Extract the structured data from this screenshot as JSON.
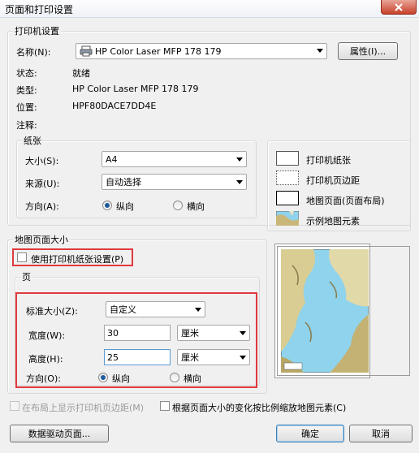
{
  "window": {
    "title": "页面和打印设置"
  },
  "printer": {
    "group_title": "打印机设置",
    "name_label": "名称(N):",
    "name_value": "HP Color Laser MFP 178 179",
    "properties_button": "属性(I)...",
    "status_label": "状态:",
    "status_value": "就绪",
    "type_label": "类型:",
    "type_value": "HP Color Laser MFP 178 179",
    "location_label": "位置:",
    "location_value": "HPF80DACE7DD4E",
    "comment_label": "注释:",
    "comment_value": ""
  },
  "paper": {
    "group_title": "纸张",
    "size_label": "大小(S):",
    "size_value": "A4",
    "source_label": "来源(U):",
    "source_value": "自动选择",
    "orientation_label": "方向(A):",
    "portrait": "纵向",
    "landscape": "横向",
    "selected": "纵向"
  },
  "legend": {
    "items": [
      "打印机纸张",
      "打印机页边距",
      "地图页面(页面布局)",
      "示例地图元素"
    ]
  },
  "map_page": {
    "group_title": "地图页面大小",
    "use_printer_paper": "使用打印机纸张设置(P)",
    "use_printer_paper_checked": false,
    "page_group_title": "页",
    "standard_size_label": "标准大小(Z):",
    "standard_size_value": "自定义",
    "width_label": "宽度(W):",
    "width_value": "30",
    "width_unit": "厘米",
    "height_label": "高度(H):",
    "height_value": "25",
    "height_unit": "厘米",
    "orientation_label": "方向(O):",
    "portrait": "纵向",
    "landscape": "横向",
    "selected": "纵向"
  },
  "options": {
    "show_printer_margins": "在布局上显示打印机页边距(M)",
    "show_printer_margins_enabled": false,
    "scale_elements": "根据页面大小的变化按比例缩放地图元素(C)",
    "scale_elements_checked": false
  },
  "buttons": {
    "data_driven": "数据驱动页面...",
    "ok": "确定",
    "cancel": "取消"
  },
  "colors": {
    "highlight_red": "#e0393e",
    "map_water": "#8fd3ec",
    "map_land": "#d8c98a",
    "title_close": "#c8412b"
  }
}
